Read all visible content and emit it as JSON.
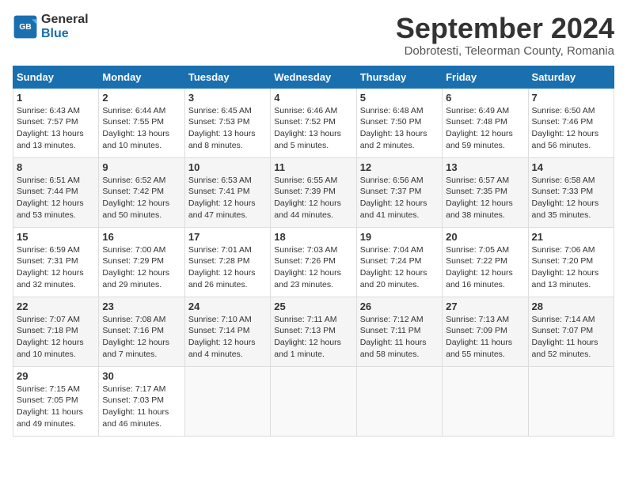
{
  "logo": {
    "line1": "General",
    "line2": "Blue"
  },
  "title": "September 2024",
  "subtitle": "Dobrotesti, Teleorman County, Romania",
  "weekdays": [
    "Sunday",
    "Monday",
    "Tuesday",
    "Wednesday",
    "Thursday",
    "Friday",
    "Saturday"
  ],
  "weeks": [
    [
      {
        "day": "1",
        "info": "Sunrise: 6:43 AM\nSunset: 7:57 PM\nDaylight: 13 hours\nand 13 minutes."
      },
      {
        "day": "2",
        "info": "Sunrise: 6:44 AM\nSunset: 7:55 PM\nDaylight: 13 hours\nand 10 minutes."
      },
      {
        "day": "3",
        "info": "Sunrise: 6:45 AM\nSunset: 7:53 PM\nDaylight: 13 hours\nand 8 minutes."
      },
      {
        "day": "4",
        "info": "Sunrise: 6:46 AM\nSunset: 7:52 PM\nDaylight: 13 hours\nand 5 minutes."
      },
      {
        "day": "5",
        "info": "Sunrise: 6:48 AM\nSunset: 7:50 PM\nDaylight: 13 hours\nand 2 minutes."
      },
      {
        "day": "6",
        "info": "Sunrise: 6:49 AM\nSunset: 7:48 PM\nDaylight: 12 hours\nand 59 minutes."
      },
      {
        "day": "7",
        "info": "Sunrise: 6:50 AM\nSunset: 7:46 PM\nDaylight: 12 hours\nand 56 minutes."
      }
    ],
    [
      {
        "day": "8",
        "info": "Sunrise: 6:51 AM\nSunset: 7:44 PM\nDaylight: 12 hours\nand 53 minutes."
      },
      {
        "day": "9",
        "info": "Sunrise: 6:52 AM\nSunset: 7:42 PM\nDaylight: 12 hours\nand 50 minutes."
      },
      {
        "day": "10",
        "info": "Sunrise: 6:53 AM\nSunset: 7:41 PM\nDaylight: 12 hours\nand 47 minutes."
      },
      {
        "day": "11",
        "info": "Sunrise: 6:55 AM\nSunset: 7:39 PM\nDaylight: 12 hours\nand 44 minutes."
      },
      {
        "day": "12",
        "info": "Sunrise: 6:56 AM\nSunset: 7:37 PM\nDaylight: 12 hours\nand 41 minutes."
      },
      {
        "day": "13",
        "info": "Sunrise: 6:57 AM\nSunset: 7:35 PM\nDaylight: 12 hours\nand 38 minutes."
      },
      {
        "day": "14",
        "info": "Sunrise: 6:58 AM\nSunset: 7:33 PM\nDaylight: 12 hours\nand 35 minutes."
      }
    ],
    [
      {
        "day": "15",
        "info": "Sunrise: 6:59 AM\nSunset: 7:31 PM\nDaylight: 12 hours\nand 32 minutes."
      },
      {
        "day": "16",
        "info": "Sunrise: 7:00 AM\nSunset: 7:29 PM\nDaylight: 12 hours\nand 29 minutes."
      },
      {
        "day": "17",
        "info": "Sunrise: 7:01 AM\nSunset: 7:28 PM\nDaylight: 12 hours\nand 26 minutes."
      },
      {
        "day": "18",
        "info": "Sunrise: 7:03 AM\nSunset: 7:26 PM\nDaylight: 12 hours\nand 23 minutes."
      },
      {
        "day": "19",
        "info": "Sunrise: 7:04 AM\nSunset: 7:24 PM\nDaylight: 12 hours\nand 20 minutes."
      },
      {
        "day": "20",
        "info": "Sunrise: 7:05 AM\nSunset: 7:22 PM\nDaylight: 12 hours\nand 16 minutes."
      },
      {
        "day": "21",
        "info": "Sunrise: 7:06 AM\nSunset: 7:20 PM\nDaylight: 12 hours\nand 13 minutes."
      }
    ],
    [
      {
        "day": "22",
        "info": "Sunrise: 7:07 AM\nSunset: 7:18 PM\nDaylight: 12 hours\nand 10 minutes."
      },
      {
        "day": "23",
        "info": "Sunrise: 7:08 AM\nSunset: 7:16 PM\nDaylight: 12 hours\nand 7 minutes."
      },
      {
        "day": "24",
        "info": "Sunrise: 7:10 AM\nSunset: 7:14 PM\nDaylight: 12 hours\nand 4 minutes."
      },
      {
        "day": "25",
        "info": "Sunrise: 7:11 AM\nSunset: 7:13 PM\nDaylight: 12 hours\nand 1 minute."
      },
      {
        "day": "26",
        "info": "Sunrise: 7:12 AM\nSunset: 7:11 PM\nDaylight: 11 hours\nand 58 minutes."
      },
      {
        "day": "27",
        "info": "Sunrise: 7:13 AM\nSunset: 7:09 PM\nDaylight: 11 hours\nand 55 minutes."
      },
      {
        "day": "28",
        "info": "Sunrise: 7:14 AM\nSunset: 7:07 PM\nDaylight: 11 hours\nand 52 minutes."
      }
    ],
    [
      {
        "day": "29",
        "info": "Sunrise: 7:15 AM\nSunset: 7:05 PM\nDaylight: 11 hours\nand 49 minutes."
      },
      {
        "day": "30",
        "info": "Sunrise: 7:17 AM\nSunset: 7:03 PM\nDaylight: 11 hours\nand 46 minutes."
      },
      {
        "day": "",
        "info": ""
      },
      {
        "day": "",
        "info": ""
      },
      {
        "day": "",
        "info": ""
      },
      {
        "day": "",
        "info": ""
      },
      {
        "day": "",
        "info": ""
      }
    ]
  ]
}
